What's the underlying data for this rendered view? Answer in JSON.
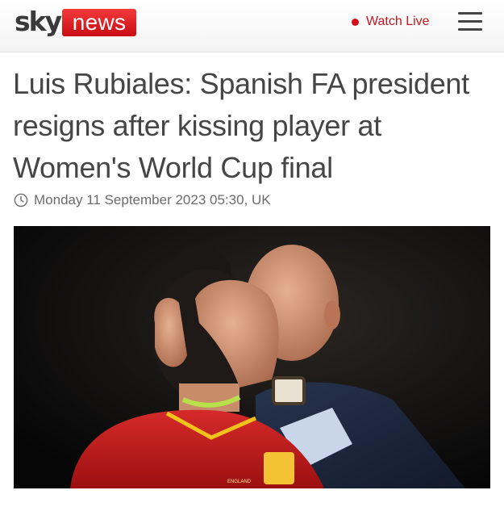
{
  "header": {
    "logo": {
      "sky": "sky",
      "news": "news"
    },
    "watch_live_label": "Watch Live",
    "menu_icon": "hamburger-menu-icon"
  },
  "article": {
    "headline": "Luis Rubiales: Spanish FA president resigns after kissing player at Women's World Cup final",
    "date_icon": "clock-icon",
    "date": "Monday 11 September 2023 05:30, UK"
  },
  "colors": {
    "brand_red": "#c90d14",
    "live_red": "#d0111a",
    "headline_text": "#454545",
    "date_text": "#6b6b6b"
  }
}
